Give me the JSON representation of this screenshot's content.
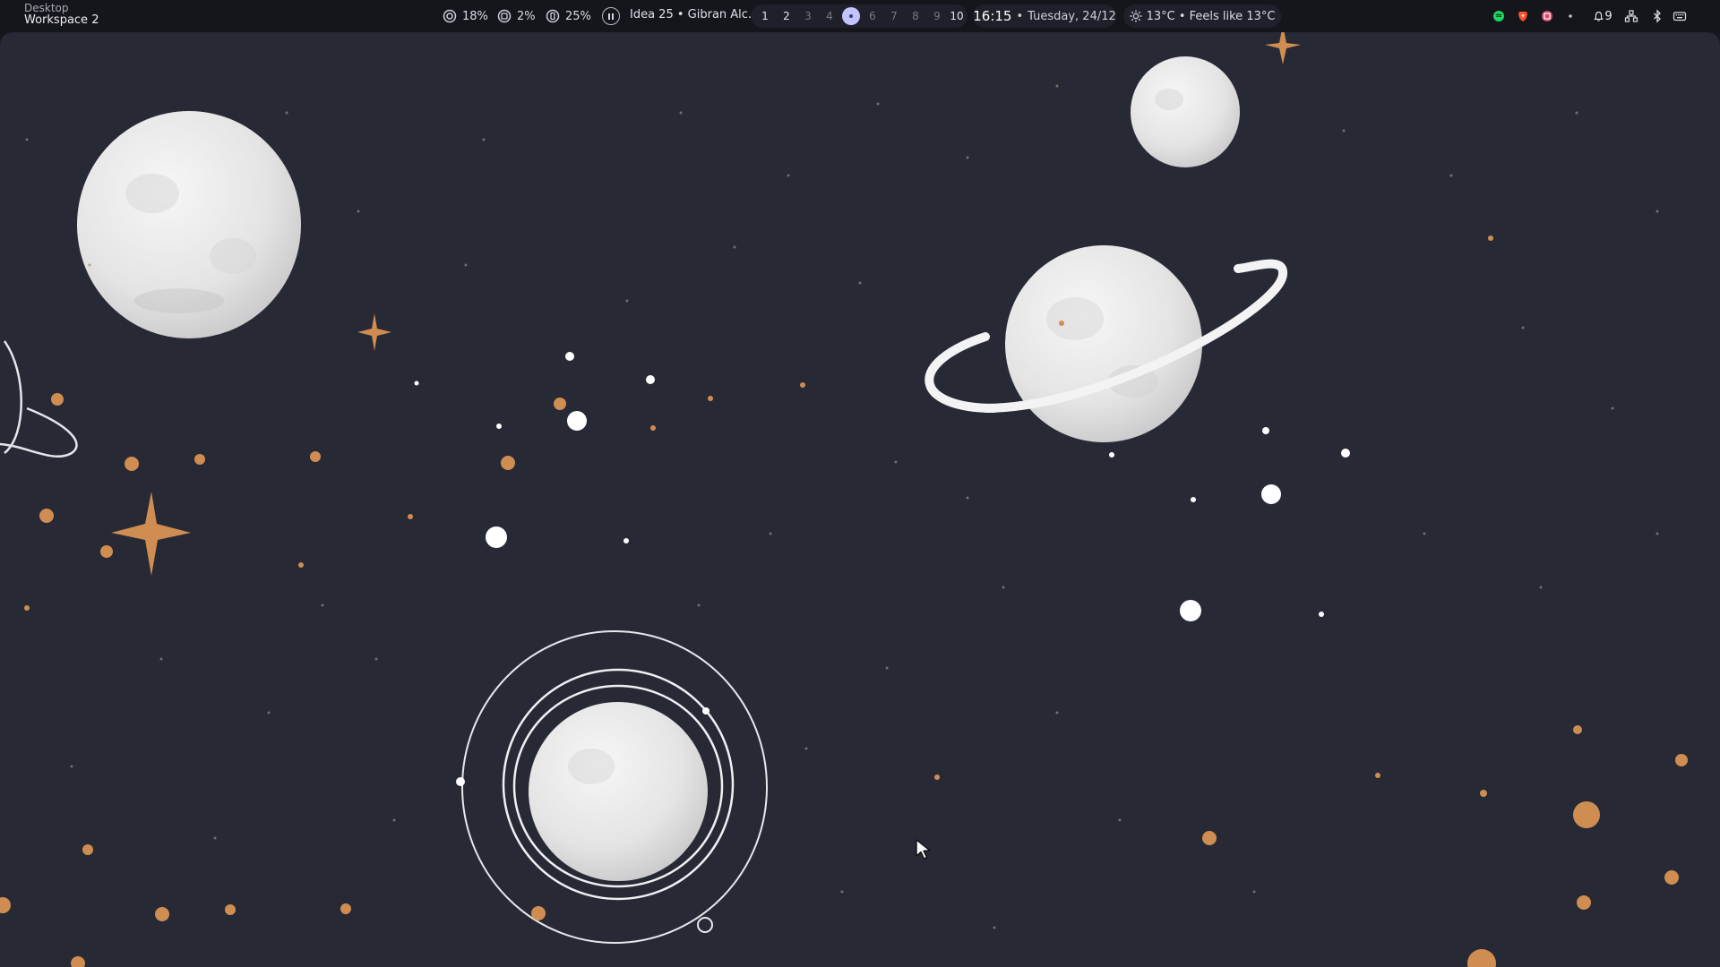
{
  "window": {
    "class_name": "Desktop",
    "title": "Workspace 2"
  },
  "resources": [
    {
      "icon": "memory-icon",
      "value": "18%"
    },
    {
      "icon": "cpu-icon",
      "value": "2%"
    },
    {
      "icon": "battery-icon",
      "value": "25%"
    }
  ],
  "media": {
    "icon": "pause-icon",
    "text": "Idea 25 • Gibran Alc..."
  },
  "workspaces": [
    "1",
    "2",
    "3",
    "4",
    "5",
    "6",
    "7",
    "8",
    "9",
    "10"
  ],
  "active_workspace": "5",
  "clock": {
    "time": "16:15",
    "separator": "•",
    "date": "Tuesday, 24/12"
  },
  "weather": {
    "icon": "sun-icon",
    "text": "13°C • Feels like 13°C"
  },
  "tray": {
    "items": [
      "spotify-icon",
      "brave-icon",
      "tray-app-icon",
      "tray-dot-icon"
    ],
    "notifications": {
      "icon": "bell-icon",
      "count": "9"
    },
    "system": [
      "network-icon",
      "bluetooth-icon",
      "keyboard-icon"
    ]
  },
  "colors": {
    "bar_bg": "#15161c",
    "pill_bg": "#1f2029",
    "active_workspace": "#c2c4ff",
    "wallpaper_bg": "#272935",
    "star_orange": "#d08d52",
    "planet": "#e7e7e7",
    "spotify_green": "#1ed760",
    "brave_orange": "#fb542b"
  }
}
